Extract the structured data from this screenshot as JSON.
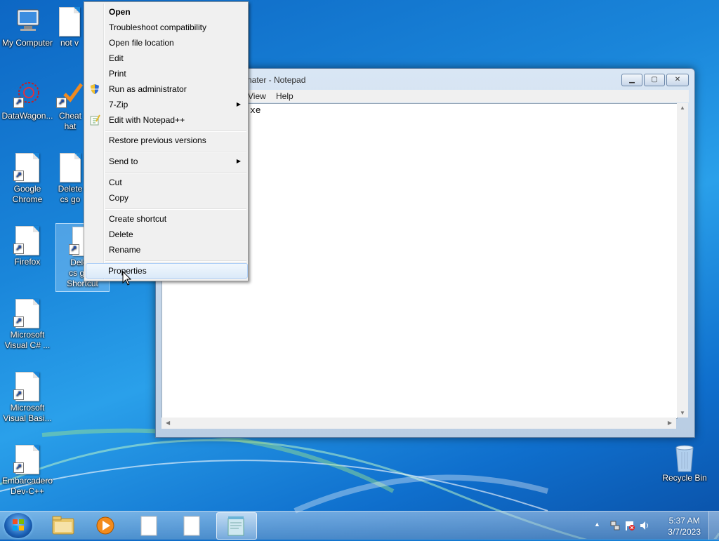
{
  "desktop": {
    "icons": [
      {
        "label": "My Computer"
      },
      {
        "label": "not v"
      },
      {
        "label": "DataWagon..."
      },
      {
        "label": "Cheat",
        "label2": "hat"
      },
      {
        "label": "Google",
        "label2": "Chrome"
      },
      {
        "label": "Delete",
        "label2": "cs go"
      },
      {
        "label": "Firefox"
      },
      {
        "label": "Delete",
        "label2": "cs go h",
        "label3": "Shortcut"
      },
      {
        "label": "Microsoft",
        "label2": "Visual C# ..."
      },
      {
        "label": "Microsoft",
        "label2": "Visual Basi..."
      },
      {
        "label": "Embarcadero",
        "label2": "Dev-C++"
      },
      {
        "label": "Recycle Bin"
      }
    ]
  },
  "notepad": {
    "title": "nater - Notepad",
    "menu": {
      "view": "View",
      "help": "Help"
    },
    "content": "xe",
    "buttons": {
      "minimize": "▁",
      "maximize": "▢",
      "close": "✕"
    }
  },
  "context_menu": {
    "items": [
      {
        "label": "Open"
      },
      {
        "label": "Troubleshoot compatibility"
      },
      {
        "label": "Open file location"
      },
      {
        "label": "Edit"
      },
      {
        "label": "Print"
      },
      {
        "label": "Run as administrator"
      },
      {
        "label": "7-Zip"
      },
      {
        "label": "Edit with Notepad++"
      },
      {
        "label": "Restore previous versions"
      },
      {
        "label": "Send to"
      },
      {
        "label": "Cut"
      },
      {
        "label": "Copy"
      },
      {
        "label": "Create shortcut"
      },
      {
        "label": "Delete"
      },
      {
        "label": "Rename"
      },
      {
        "label": "Properties"
      }
    ],
    "submenu_glyph": "▶"
  },
  "taskbar": {
    "clock_time": "5:37 AM",
    "clock_date": "3/7/2023",
    "tray_expand": "▲"
  }
}
